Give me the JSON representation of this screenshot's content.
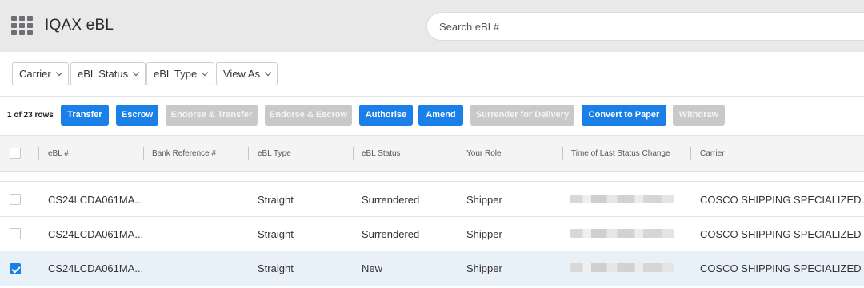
{
  "header": {
    "app_title": "IQAX eBL",
    "search_placeholder": "Search eBL#"
  },
  "filters": [
    {
      "label": "Carrier"
    },
    {
      "label": "eBL Status"
    },
    {
      "label": "eBL Type"
    },
    {
      "label": "View As"
    }
  ],
  "actions": {
    "row_count": "1 of 23 rows",
    "buttons": [
      {
        "label": "Transfer",
        "enabled": true
      },
      {
        "label": "Escrow",
        "enabled": true
      },
      {
        "label": "Endorse & Transfer",
        "enabled": false
      },
      {
        "label": "Endorse & Escrow",
        "enabled": false
      },
      {
        "label": "Authorise",
        "enabled": true
      },
      {
        "label": "Amend",
        "enabled": true
      },
      {
        "label": "Surrender for Delivery",
        "enabled": false
      },
      {
        "label": "Convert to Paper",
        "enabled": true
      },
      {
        "label": "Withdraw",
        "enabled": false
      }
    ]
  },
  "table": {
    "columns": [
      "eBL #",
      "Bank Reference #",
      "eBL Type",
      "eBL Status",
      "Your Role",
      "Time of Last Status Change",
      "Carrier"
    ],
    "rows": [
      {
        "ebl": "CS24LCDA061MA...",
        "bank_ref": "",
        "type": "Straight",
        "status": "Surrendered",
        "role": "Shipper",
        "time": "",
        "carrier": "COSCO SHIPPING SPECIALIZED C...",
        "checked": false
      },
      {
        "ebl": "CS24LCDA061MA...",
        "bank_ref": "",
        "type": "Straight",
        "status": "Surrendered",
        "role": "Shipper",
        "time": "",
        "carrier": "COSCO SHIPPING SPECIALIZED C...",
        "checked": false
      },
      {
        "ebl": "CS24LCDA061MA...",
        "bank_ref": "",
        "type": "Straight",
        "status": "New",
        "role": "Shipper",
        "time": "",
        "carrier": "COSCO SHIPPING SPECIALIZED C...",
        "checked": true
      }
    ]
  },
  "colors": {
    "accent": "#1a7fe6",
    "disabled": "#c9c9cc",
    "header_bg": "#e9e9ea",
    "selected_row": "#e8f0f8"
  }
}
